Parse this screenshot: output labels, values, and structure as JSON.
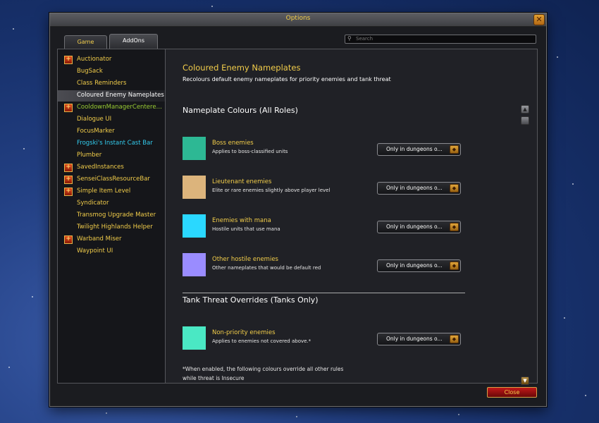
{
  "window": {
    "title": "Options"
  },
  "tabs": [
    {
      "label": "Game"
    },
    {
      "label": "AddOns"
    }
  ],
  "search": {
    "placeholder": "Search"
  },
  "sidebar": {
    "items": [
      {
        "label": "Auctionator",
        "expandable": true,
        "color": "#f2cd4a"
      },
      {
        "label": "BugSack",
        "expandable": false,
        "color": "#f2cd4a"
      },
      {
        "label": "Class Reminders",
        "expandable": false,
        "color": "#f2cd4a"
      },
      {
        "label": "Coloured Enemy Nameplates",
        "expandable": false,
        "color": "#ffffff",
        "selected": true
      },
      {
        "label": "CooldownManagerCenteredRow",
        "expandable": true,
        "color": "#9acd32"
      },
      {
        "label": "Dialogue UI",
        "expandable": false,
        "color": "#f2cd4a"
      },
      {
        "label": "FocusMarker",
        "expandable": false,
        "color": "#f2cd4a"
      },
      {
        "label": "Frogski's Instant Cast Bar",
        "expandable": false,
        "color": "#33ccee"
      },
      {
        "label": "Plumber",
        "expandable": false,
        "color": "#f2cd4a"
      },
      {
        "label": "SavedInstances",
        "expandable": true,
        "color": "#f2cd4a"
      },
      {
        "label": "SenseiClassResourceBar",
        "expandable": true,
        "color": "#f2cd4a"
      },
      {
        "label": "Simple Item Level",
        "expandable": true,
        "color": "#f2cd4a"
      },
      {
        "label": "Syndicator",
        "expandable": false,
        "color": "#f2cd4a"
      },
      {
        "label": "Transmog Upgrade Master",
        "expandable": false,
        "color": "#f2cd4a"
      },
      {
        "label": "Twilight Highlands Helper",
        "expandable": false,
        "color": "#f2cd4a"
      },
      {
        "label": "Warband Miser",
        "expandable": true,
        "color": "#f2cd4a"
      },
      {
        "label": "Waypoint UI",
        "expandable": false,
        "color": "#f2cd4a"
      }
    ]
  },
  "main": {
    "title": "Coloured Enemy Nameplates",
    "description": "Recolours default enemy nameplates for priority enemies and tank threat",
    "section1": "Nameplate Colours (All Roles)",
    "section2": "Tank Threat Overrides (Tanks Only)",
    "options": [
      {
        "name": "Boss enemies",
        "desc": "Applies to boss-classified units",
        "color": "#2db894",
        "dropdown": "Only in dungeons o..."
      },
      {
        "name": "Lieutenant enemies",
        "desc": "Elite or rare enemies slightly above player level",
        "color": "#dcb47c",
        "dropdown": "Only in dungeons o..."
      },
      {
        "name": "Enemies with mana",
        "desc": "Hostile units that use mana",
        "color": "#2ad8ff",
        "dropdown": "Only in dungeons o..."
      },
      {
        "name": "Other hostile enemies",
        "desc": "Other nameplates that would be default red",
        "color": "#9a8cff",
        "dropdown": "Only in dungeons o..."
      }
    ],
    "tank_options": [
      {
        "name": "Non-priority enemies",
        "desc": "Applies to enemies not covered above.*",
        "color": "#4ae8c4",
        "dropdown": "Only in dungeons o..."
      }
    ],
    "note_line1": "*When enabled, the following colours override all other rules",
    "note_line2": "while threat is Insecure"
  },
  "footer": {
    "close_label": "Close"
  }
}
